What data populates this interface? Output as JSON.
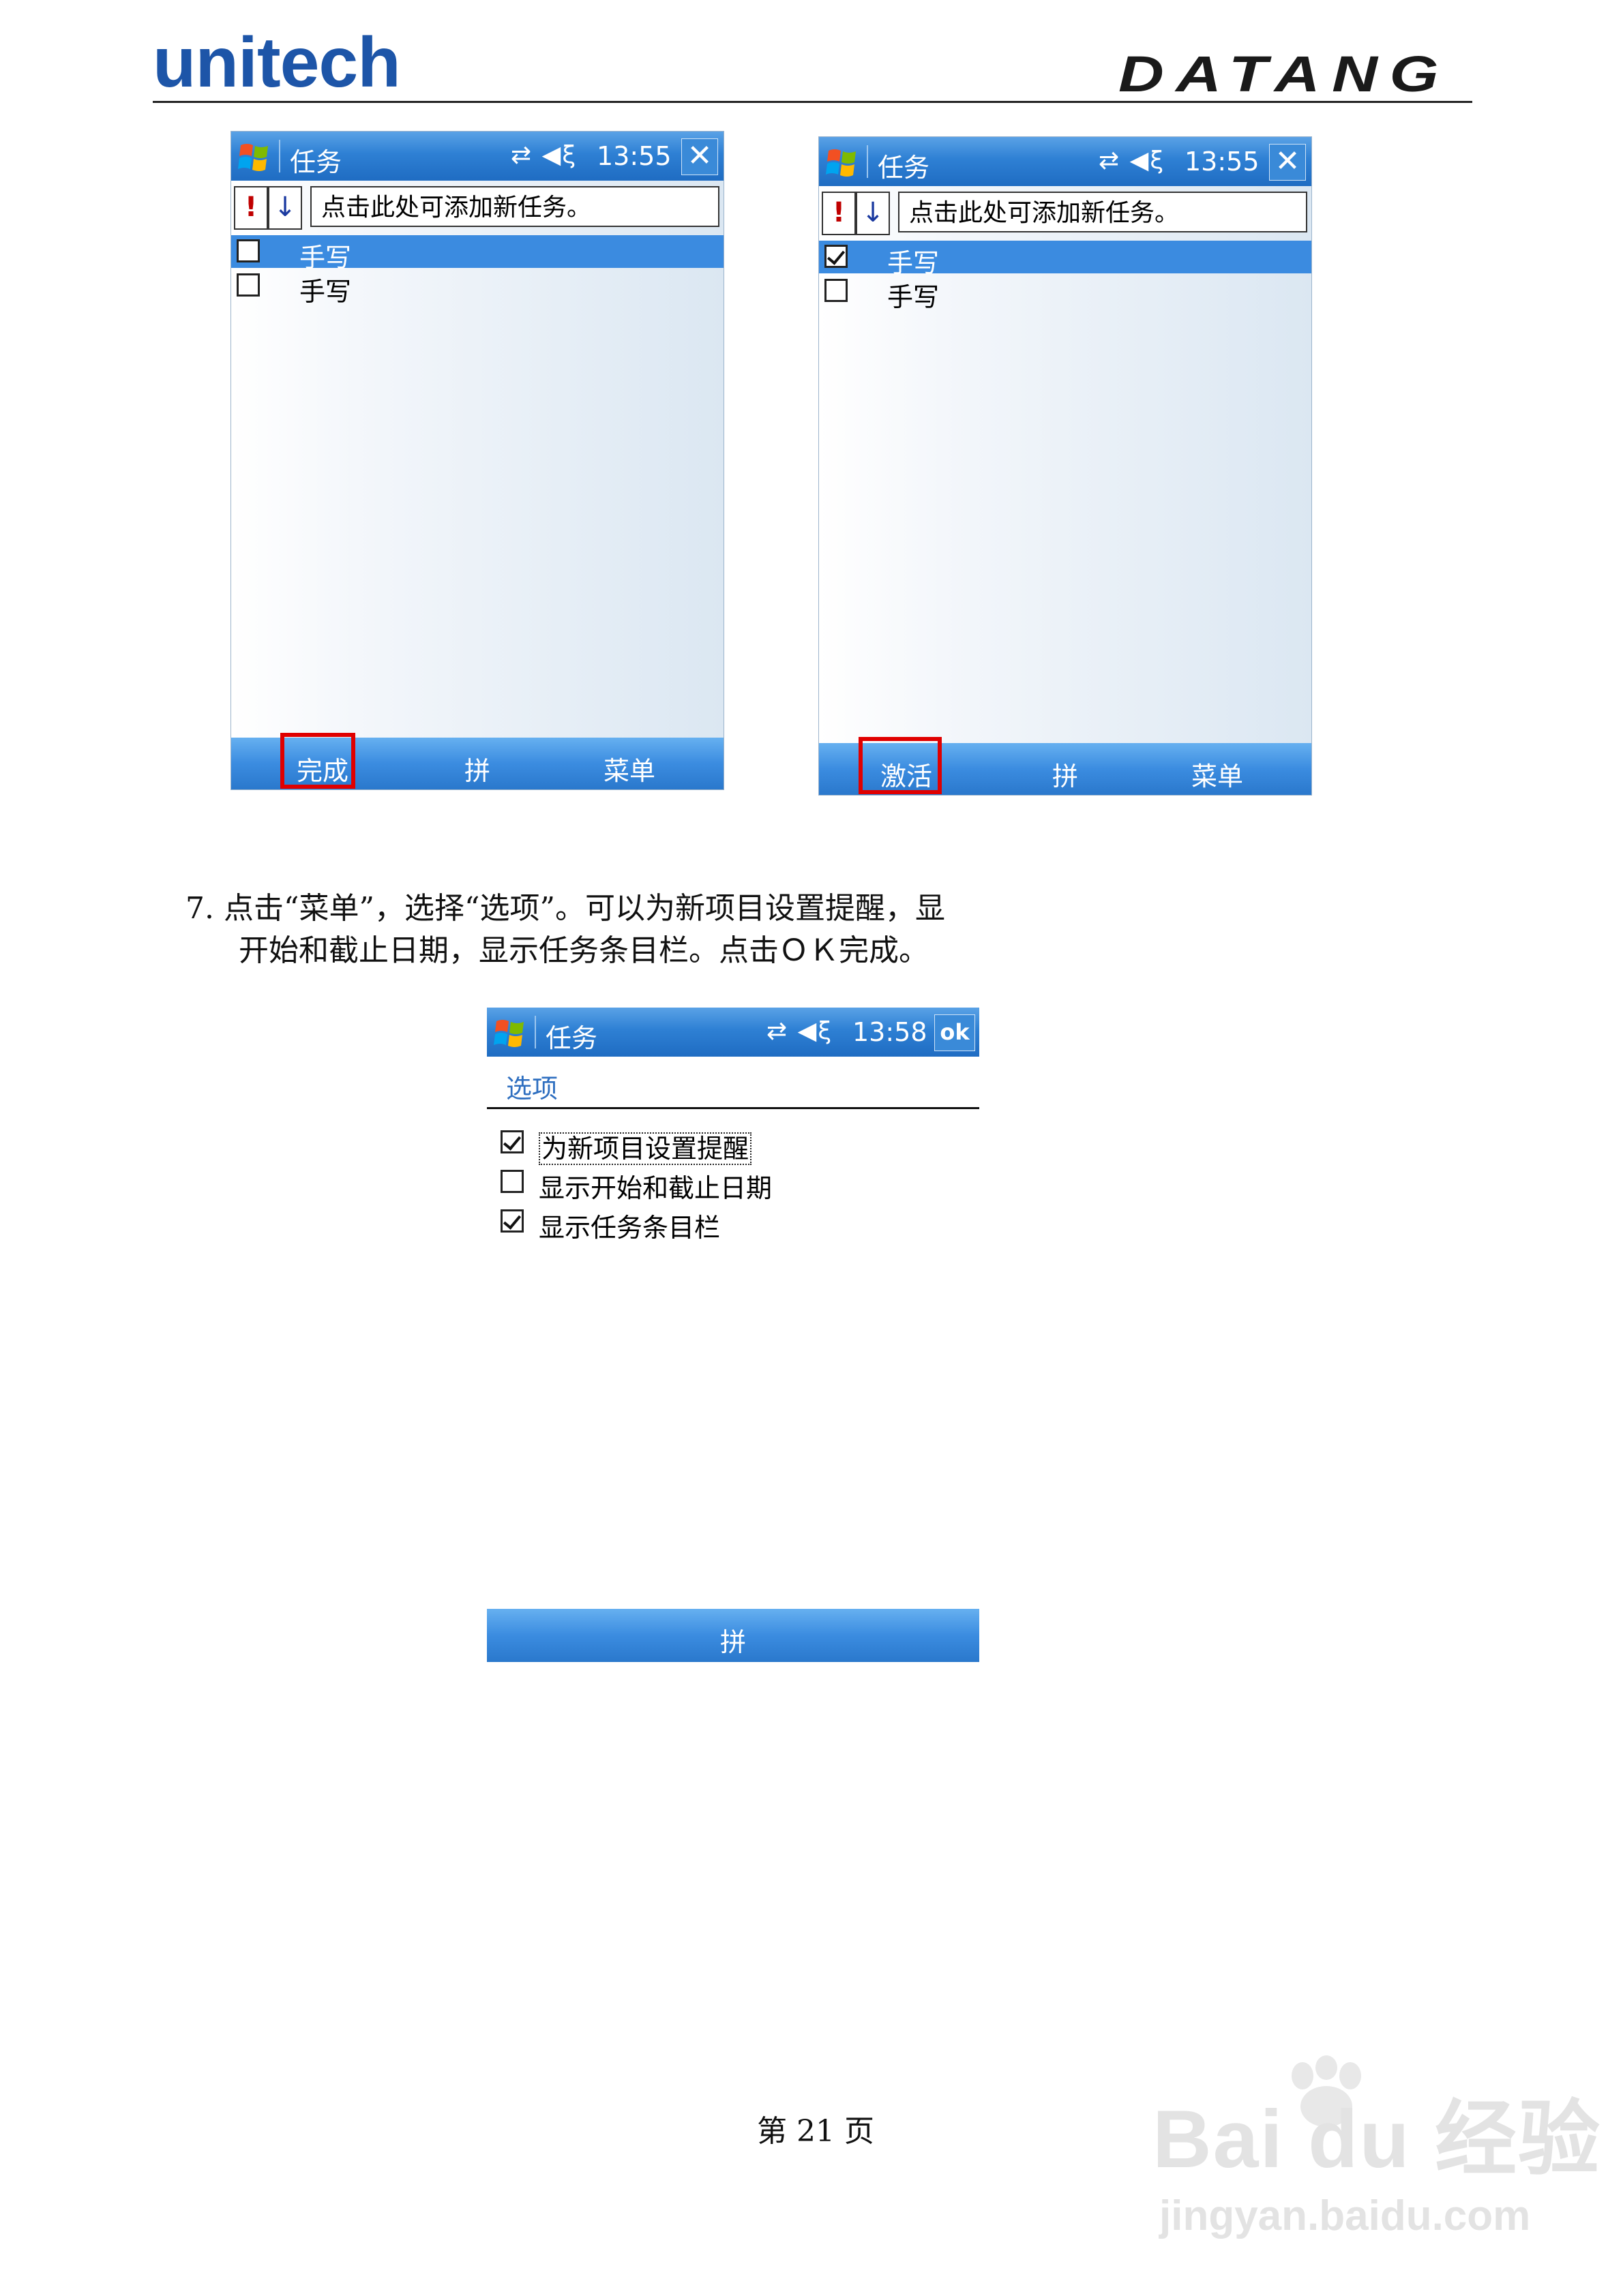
{
  "header": {
    "brand_left": "unitech",
    "brand_right": "DATANG"
  },
  "screen1": {
    "title": "任务",
    "status_icons": "⇄ ◀ξ",
    "time": "13:55",
    "close": "✕",
    "priority_icon": "!",
    "sort_icon": "↓",
    "add_task_prompt": "点击此处可添加新任务。",
    "items": [
      {
        "label": "手写",
        "checked": false,
        "selected": true
      },
      {
        "label": "手写",
        "checked": false,
        "selected": false
      }
    ],
    "softkeys": {
      "left": "完成",
      "center": "拼",
      "right": "菜单"
    }
  },
  "screen2": {
    "title": "任务",
    "status_icons": "⇄ ◀ξ",
    "time": "13:55",
    "close": "✕",
    "priority_icon": "!",
    "sort_icon": "↓",
    "add_task_prompt": "点击此处可添加新任务。",
    "items": [
      {
        "label": "手写",
        "checked": true,
        "selected": true
      },
      {
        "label": "手写",
        "checked": false,
        "selected": false
      }
    ],
    "softkeys": {
      "left": "激活",
      "center": "拼",
      "right": "菜单"
    }
  },
  "instruction": {
    "line1": "7.  点击“菜单”，选择“选项”。可以为新项目设置提醒，显",
    "line2": "开始和截止日期，显示任务条目栏。点击ＯＫ完成。"
  },
  "screen3": {
    "title": "任务",
    "status_icons": "⇄ ◀ξ",
    "time": "13:58",
    "ok": "ok",
    "section_title": "选项",
    "options": [
      {
        "label": "为新项目设置提醒",
        "checked": true
      },
      {
        "label": "显示开始和截止日期",
        "checked": false
      },
      {
        "label": "显示任务条目栏",
        "checked": true
      }
    ],
    "softkeys": {
      "center": "拼"
    }
  },
  "footer": {
    "page": "第 21 页"
  },
  "watermark": {
    "main": "Bai du 经验",
    "url": "jingyan.baidu.com"
  },
  "colors": {
    "titlebar": "#2e80d4",
    "selection": "#3b8be0",
    "highlight_box": "#e00000",
    "brand_blue": "#1d55a8"
  }
}
